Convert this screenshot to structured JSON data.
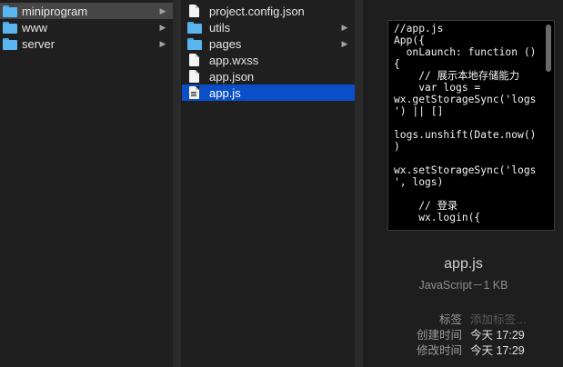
{
  "column1": {
    "items": [
      {
        "label": "miniprogram",
        "type": "folder",
        "has_arrow": true,
        "state": "selected-inactive"
      },
      {
        "label": "www",
        "type": "folder",
        "has_arrow": true,
        "state": "normal"
      },
      {
        "label": "server",
        "type": "folder",
        "has_arrow": true,
        "state": "normal"
      }
    ]
  },
  "column2": {
    "items": [
      {
        "label": "project.config.json",
        "type": "file",
        "has_arrow": false
      },
      {
        "label": "utils",
        "type": "folder",
        "has_arrow": true
      },
      {
        "label": "pages",
        "type": "folder",
        "has_arrow": true
      },
      {
        "label": "app.wxss",
        "type": "file",
        "has_arrow": false
      },
      {
        "label": "app.json",
        "type": "file",
        "has_arrow": false
      },
      {
        "label": "app.js",
        "type": "file",
        "has_arrow": false,
        "state": "selected-active"
      }
    ]
  },
  "arrow_glyph": "▶",
  "preview": {
    "code": "//app.js\nApp({\n  onLaunch: function ()\n{\n    // 展示本地存储能力\n    var logs =\nwx.getStorageSync('logs\n') || []\n\nlogs.unshift(Date.now()\n)\n\nwx.setStorageSync('logs\n', logs)\n\n    // 登录\n    wx.login({",
    "filename": "app.js",
    "filetype": "JavaScript－1 KB",
    "meta": {
      "tags_label": "标签",
      "tags_placeholder": "添加标签…",
      "created_label": "创建时间",
      "created_value": "今天 17:29",
      "modified_label": "修改时间",
      "modified_value": "今天 17:29"
    }
  },
  "colors": {
    "selection_blue": "#0a4fc7",
    "selection_gray": "#464646",
    "folder_blue": "#5ab6ee"
  }
}
